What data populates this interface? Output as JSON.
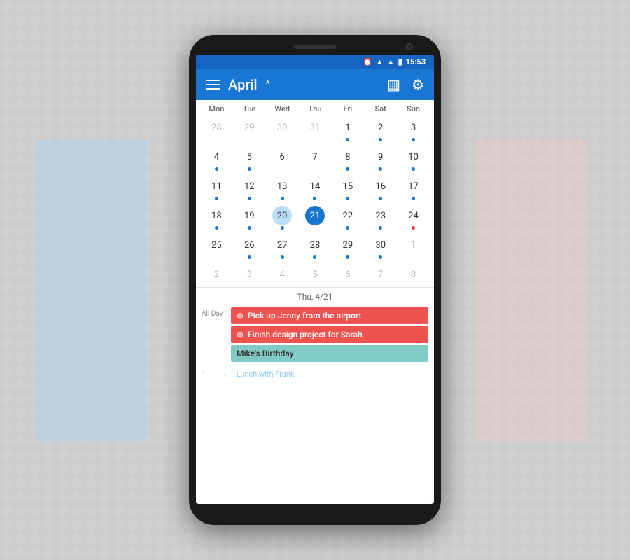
{
  "phone": {
    "status_bar": {
      "time": "15:53",
      "icons": [
        "alarm",
        "wifi",
        "signal",
        "battery"
      ]
    },
    "toolbar": {
      "title": "April",
      "hamburger_label": "menu",
      "chevron_label": "^",
      "calendar_view_icon": "calendar-view",
      "settings_label": "settings"
    },
    "calendar": {
      "day_headers": [
        "Mon",
        "Tue",
        "Wed",
        "Thu",
        "Fri",
        "Sat",
        "Sun"
      ],
      "weeks": [
        [
          {
            "num": "28",
            "other": true,
            "dot": false
          },
          {
            "num": "29",
            "other": true,
            "dot": false
          },
          {
            "num": "30",
            "other": true,
            "dot": false
          },
          {
            "num": "31",
            "other": true,
            "dot": false
          },
          {
            "num": "1",
            "dot": true,
            "dot_color": "blue"
          },
          {
            "num": "2",
            "dot": true,
            "dot_color": "blue"
          },
          {
            "num": "3",
            "dot": true,
            "dot_color": "blue"
          }
        ],
        [
          {
            "num": "4",
            "dot": true,
            "dot_color": "blue"
          },
          {
            "num": "5",
            "dot": true,
            "dot_color": "blue"
          },
          {
            "num": "6",
            "dot": false
          },
          {
            "num": "7",
            "dot": false
          },
          {
            "num": "8",
            "dot": true,
            "dot_color": "blue"
          },
          {
            "num": "9",
            "dot": true,
            "dot_color": "blue"
          },
          {
            "num": "10",
            "dot": true,
            "dot_color": "blue"
          }
        ],
        [
          {
            "num": "11",
            "dot": true,
            "dot_color": "blue"
          },
          {
            "num": "12",
            "dot": true,
            "dot_color": "blue"
          },
          {
            "num": "13",
            "dot": true,
            "dot_color": "blue"
          },
          {
            "num": "14",
            "dot": true,
            "dot_color": "blue"
          },
          {
            "num": "15",
            "dot": true,
            "dot_color": "blue"
          },
          {
            "num": "16",
            "dot": true,
            "dot_color": "blue"
          },
          {
            "num": "17",
            "dot": true,
            "dot_color": "blue"
          }
        ],
        [
          {
            "num": "18",
            "dot": true,
            "dot_color": "blue"
          },
          {
            "num": "19",
            "dot": true,
            "dot_color": "blue"
          },
          {
            "num": "20",
            "near_today": true,
            "dot": true,
            "dot_color": "blue"
          },
          {
            "num": "21",
            "today": true,
            "dot": false
          },
          {
            "num": "22",
            "dot": true,
            "dot_color": "blue"
          },
          {
            "num": "23",
            "dot": true,
            "dot_color": "blue"
          },
          {
            "num": "24",
            "dot": true,
            "dot_color": "red"
          }
        ],
        [
          {
            "num": "25",
            "dot": false
          },
          {
            "num": "26",
            "dot": true,
            "dot_color": "blue"
          },
          {
            "num": "27",
            "dot": true,
            "dot_color": "blue"
          },
          {
            "num": "28",
            "dot": true,
            "dot_color": "blue"
          },
          {
            "num": "29",
            "dot": true,
            "dot_color": "blue"
          },
          {
            "num": "30",
            "dot": true,
            "dot_color": "blue"
          },
          {
            "num": "1",
            "other": true,
            "dot": false
          }
        ],
        [
          {
            "num": "2",
            "other": true,
            "dot": false
          },
          {
            "num": "3",
            "other": true,
            "dot": false
          },
          {
            "num": "4",
            "other": true,
            "dot": false
          },
          {
            "num": "5",
            "other": true,
            "dot": false
          },
          {
            "num": "6",
            "other": true,
            "dot": false
          },
          {
            "num": "7",
            "other": true,
            "dot": false
          },
          {
            "num": "8",
            "other": true,
            "dot": false
          }
        ]
      ]
    },
    "date_divider": "Thu, 4/21",
    "events": {
      "all_day_label": "All Day",
      "all_day_events": [
        {
          "label": "Pick up Jenny from the airport",
          "type": "red",
          "icon": "+"
        },
        {
          "label": "Finish design project for Sarah",
          "type": "red",
          "icon": "+"
        },
        {
          "label": "Mike's Birthday",
          "type": "teal"
        }
      ],
      "time_events": [
        {
          "time": "1",
          "label": "Lunch with Frank",
          "color": "blue"
        }
      ]
    }
  }
}
